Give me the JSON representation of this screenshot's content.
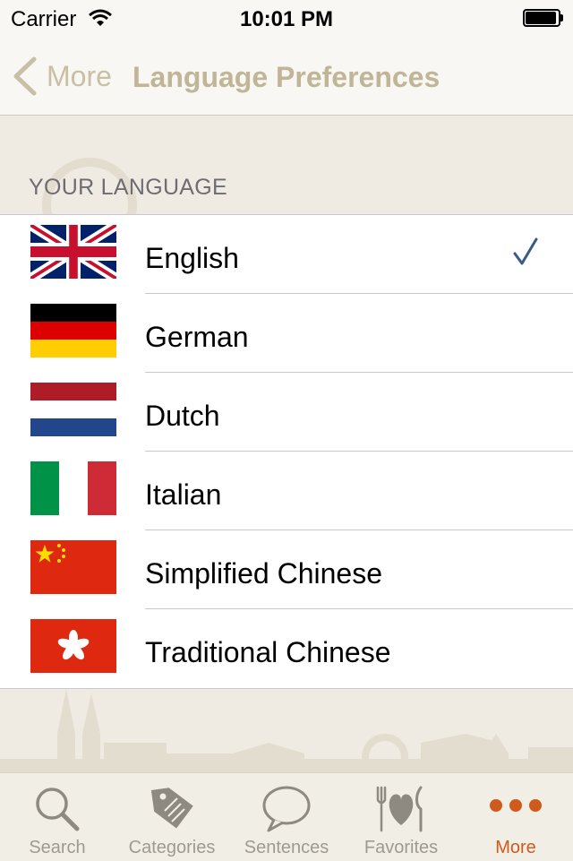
{
  "status_bar": {
    "carrier": "Carrier",
    "time": "10:01 PM"
  },
  "nav": {
    "back_label": "More",
    "title": "Language Preferences"
  },
  "section": {
    "header": "YOUR LANGUAGE"
  },
  "languages": [
    {
      "label": "English",
      "flag": "uk-flag",
      "selected": true
    },
    {
      "label": "German",
      "flag": "germany-flag",
      "selected": false
    },
    {
      "label": "Dutch",
      "flag": "netherlands-flag",
      "selected": false
    },
    {
      "label": "Italian",
      "flag": "italy-flag",
      "selected": false
    },
    {
      "label": "Simplified Chinese",
      "flag": "china-flag",
      "selected": false
    },
    {
      "label": "Traditional Chinese",
      "flag": "hong-kong-flag",
      "selected": false
    }
  ],
  "tabs": [
    {
      "label": "Search",
      "icon": "magnifier-icon"
    },
    {
      "label": "Categories",
      "icon": "tag-icon"
    },
    {
      "label": "Sentences",
      "icon": "speech-bubble-icon"
    },
    {
      "label": "Favorites",
      "icon": "fork-heart-knife-icon"
    },
    {
      "label": "More",
      "icon": "more-dots-icon",
      "active": true
    }
  ],
  "colors": {
    "accent": "#d05a1c",
    "nav_title": "#c0b596",
    "checkmark": "#3a5a8c",
    "background": "#efebe2"
  }
}
